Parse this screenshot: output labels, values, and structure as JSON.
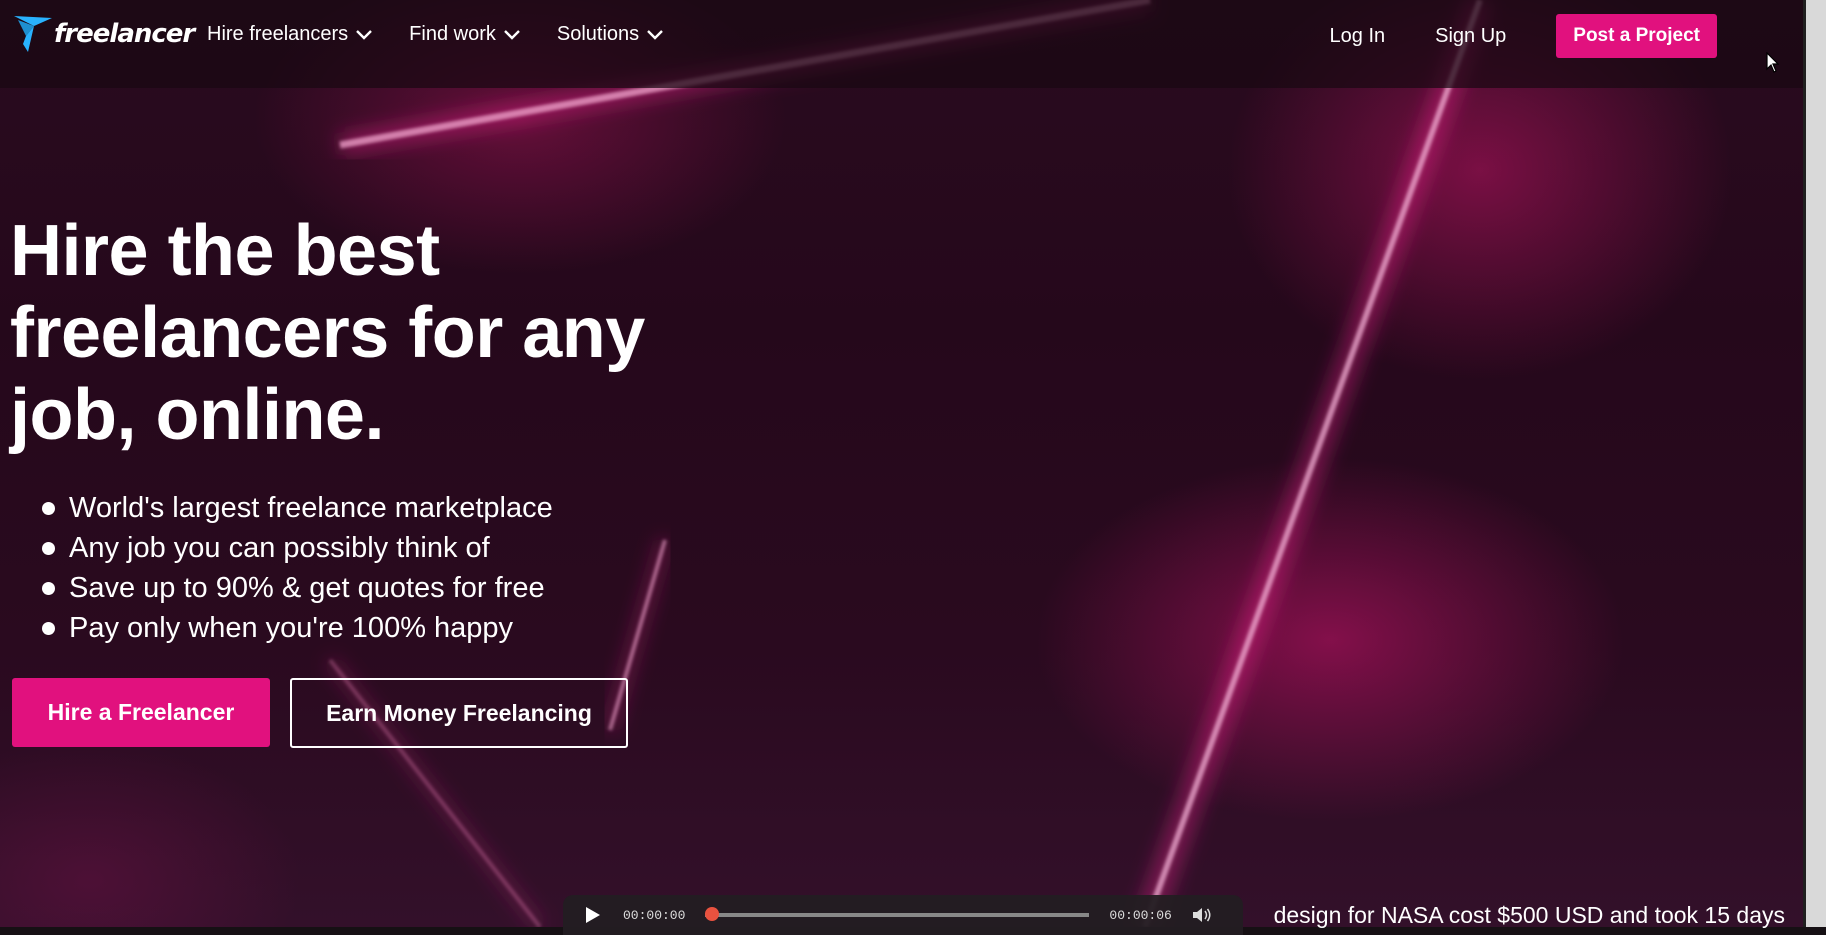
{
  "colors": {
    "brand_pink": "#e1117e",
    "brand_blue": "#29b2fe"
  },
  "nav": {
    "logo_text": "freelancer",
    "menu": [
      {
        "label": "Hire freelancers",
        "icon": "chevron-down-icon"
      },
      {
        "label": "Find work",
        "icon": "chevron-down-icon"
      },
      {
        "label": "Solutions",
        "icon": "chevron-down-icon"
      }
    ],
    "login": "Log In",
    "signup": "Sign Up",
    "post_project": "Post a Project"
  },
  "hero": {
    "headline_lines": [
      "Hire the best",
      "freelancers for any",
      "job, online."
    ],
    "bullets": [
      "World's largest freelance marketplace",
      "Any job you can possibly think of",
      "Save up to 90% & get quotes for free",
      "Pay only when you're 100% happy"
    ],
    "cta_primary": "Hire a Freelancer",
    "cta_secondary": "Earn Money Freelancing"
  },
  "player": {
    "current_time": "00:00:00",
    "duration": "00:00:06",
    "progress": 0,
    "caption": "design for NASA cost $500 USD and took 15 days"
  }
}
